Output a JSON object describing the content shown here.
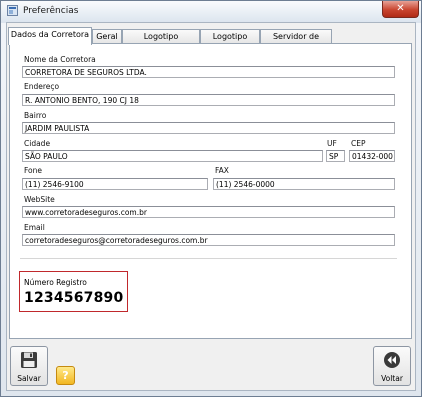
{
  "window": {
    "title": "Preferências",
    "close_glyph": "✕"
  },
  "tabs": [
    {
      "label": "Dados da Corretora"
    },
    {
      "label": "Geral"
    },
    {
      "label": "Logotipo Impressos"
    },
    {
      "label": "Logotipo Email"
    },
    {
      "label": "Servidor de Email"
    }
  ],
  "form": {
    "nome": {
      "label": "Nome da Corretora",
      "value": "CORRETORA DE SEGUROS LTDA."
    },
    "endereco": {
      "label": "Endereço",
      "value": "R. ANTONIO BENTO, 190 CJ 18"
    },
    "bairro": {
      "label": "Bairro",
      "value": "JARDIM PAULISTA"
    },
    "cidade": {
      "label": "Cidade",
      "value": "SÃO PAULO"
    },
    "uf": {
      "label": "UF",
      "value": "SP"
    },
    "cep": {
      "label": "CEP",
      "value": "01432-000"
    },
    "fone": {
      "label": "Fone",
      "value": "(11)  2546-9100"
    },
    "fax": {
      "label": "FAX",
      "value": "(11) 2546-0000"
    },
    "website": {
      "label": "WebSite",
      "value": "www.corretoradeseguros.com.br"
    },
    "email": {
      "label": "Email",
      "value": "corretoradeseguros@corretoradeseguros.com.br"
    }
  },
  "registro": {
    "label": "Número Registro",
    "value": "1234567890"
  },
  "buttons": {
    "save_label": "Salvar",
    "back_label": "Voltar",
    "help_glyph": "?"
  },
  "colors": {
    "accent_red": "#c0282c",
    "help_yellow": "#f2b722"
  }
}
